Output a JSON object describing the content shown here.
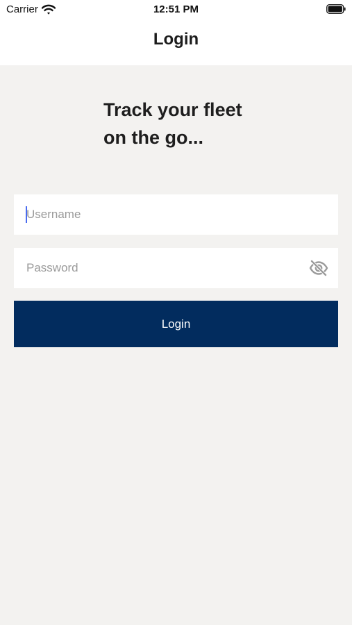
{
  "status_bar": {
    "carrier": "Carrier",
    "time": "12:51 PM"
  },
  "nav": {
    "title": "Login"
  },
  "headline": {
    "line1": "Track your fleet",
    "line2": "on the go..."
  },
  "form": {
    "username_placeholder": "Username",
    "username_value": "",
    "password_placeholder": "Password",
    "password_value": "",
    "password_toggle_icon": "eye-slash-icon",
    "login_label": "Login"
  },
  "colors": {
    "background": "#f3f2f0",
    "header_background": "#ffffff",
    "button_background": "#022c5e",
    "button_text": "#ffffff",
    "placeholder": "#9a9a9a"
  }
}
